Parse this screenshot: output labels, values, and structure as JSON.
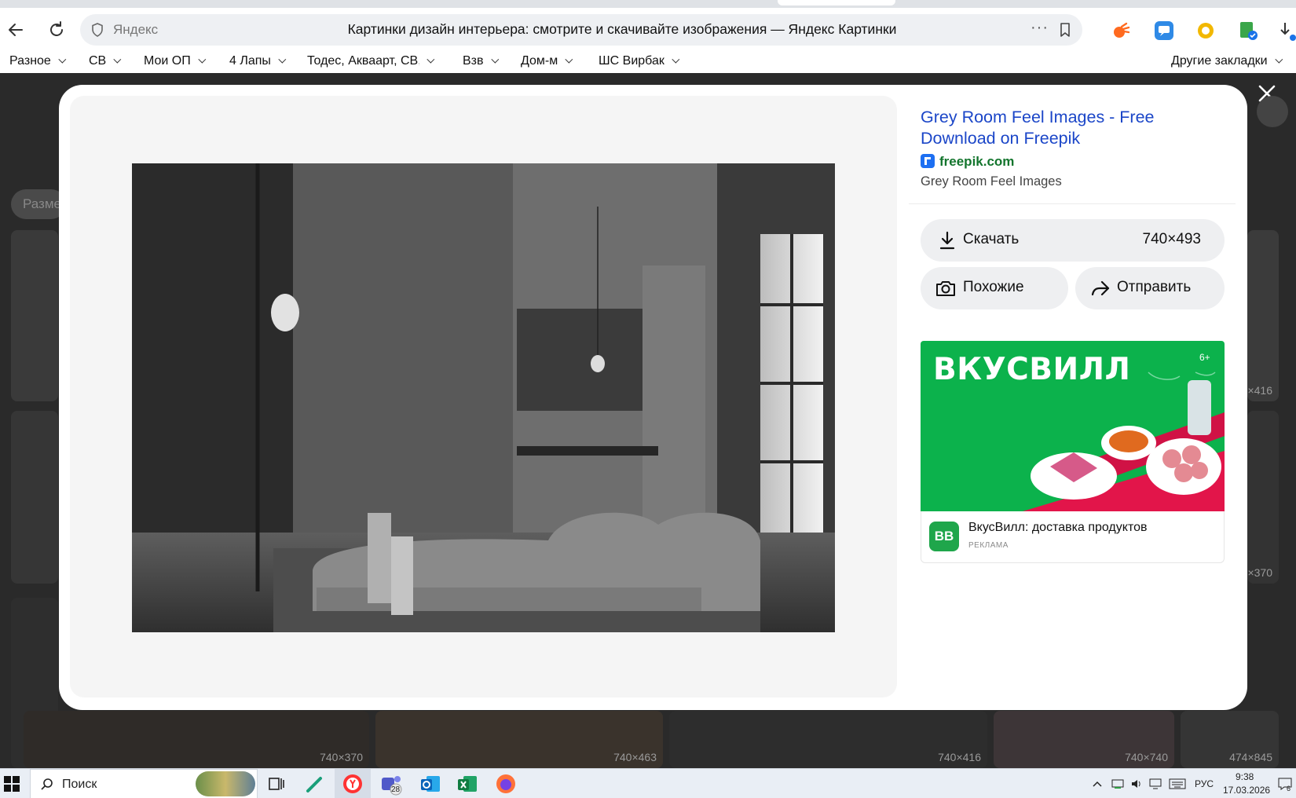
{
  "browser": {
    "address_host": "Яндекс",
    "page_title": "Картинки дизайн интерьера: смотрите и скачивайте изображения — Яндекс Картинки",
    "bookmarks": [
      "Разное",
      "СВ",
      "Мои ОП",
      "4 Лапы",
      "Тодес, Акваарт, СВ, !",
      "Взв",
      "Дом-м",
      "ШС Вирбак"
    ],
    "other_bookmarks": "Другие закладки"
  },
  "background": {
    "filter_pill": "Разме",
    "tile_sizes": [
      "740×370",
      "740×463",
      "740×416",
      "740×740",
      "474×845",
      "×416",
      "×370"
    ]
  },
  "viewer": {
    "title": "Grey Room Feel Images - Free Download on Freepik",
    "source": "freepik.com",
    "description": "Grey Room Feel Images",
    "download_label": "Скачать",
    "resolution": "740×493",
    "similar_label": "Похожие",
    "share_label": "Отправить"
  },
  "ad": {
    "brand": "ВКУСВИЛЛ",
    "age": "6+",
    "logo_text": "ВВ",
    "name": "ВкусВилл: доставка продуктов",
    "label": "РЕКЛАМА"
  },
  "taskbar": {
    "search_label": "Поиск",
    "teams_badge": "28",
    "lang": "РУС",
    "time": "9:38",
    "date": "17.03.2026",
    "notif_count": "6"
  }
}
